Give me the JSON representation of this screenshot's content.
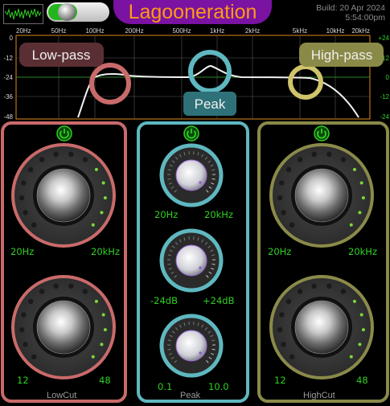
{
  "app": {
    "title": "Lagooneration",
    "build_line1": "Build: 20 Apr 2024",
    "build_line2": "5:54:00pm"
  },
  "graph": {
    "freq_labels": [
      "20Hz",
      "50Hz",
      "100Hz",
      "200Hz",
      "500Hz",
      "1kHz",
      "2kHz",
      "5kHz",
      "10kHz",
      "20kHz"
    ],
    "left_db": [
      "0",
      "-12",
      "-24",
      "-36",
      "-48"
    ],
    "right_db": [
      "+24",
      "+12",
      "0",
      "-12",
      "-24"
    ],
    "lowpass_label": "Low-pass",
    "highpass_label": "High-pass",
    "peak_label": "Peak"
  },
  "colors": {
    "lowcut": "#c96a6a",
    "peak": "#5fb8c0",
    "highcut": "#8a8a4a",
    "green_text": "#2fcf22",
    "title_bg": "#7a12a2",
    "title_text": "#ff9a15"
  },
  "lowcut": {
    "freq_min": "20Hz",
    "freq_max": "20kHz",
    "slope_min": "12",
    "slope_max": "48",
    "name": "LowCut"
  },
  "peak": {
    "freq_min": "20Hz",
    "freq_max": "20kHz",
    "gain_min": "-24dB",
    "gain_max": "+24dB",
    "q_min": "0.1",
    "q_max": "10.0",
    "name": "Peak"
  },
  "highcut": {
    "freq_min": "20Hz",
    "freq_max": "20kHz",
    "slope_min": "12",
    "slope_max": "48",
    "name": "HighCut"
  },
  "icons": {
    "power": "power-icon",
    "scope": "waveform-icon",
    "bypass": "toggle-switch"
  }
}
